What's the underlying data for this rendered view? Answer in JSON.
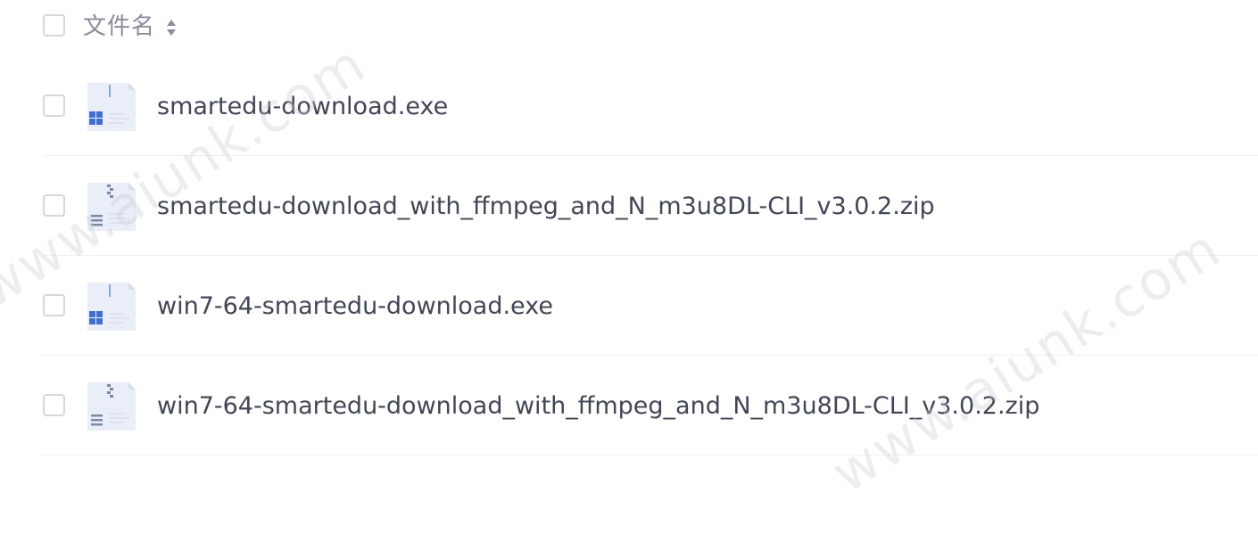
{
  "header": {
    "column_label": "文件名",
    "sort_icon": "sort-icon"
  },
  "files": [
    {
      "name": "smartedu-download.exe",
      "type": "exe",
      "icon": "exe-file-icon"
    },
    {
      "name": "smartedu-download_with_ffmpeg_and_N_m3u8DL-CLI_v3.0.2.zip",
      "type": "zip",
      "icon": "zip-file-icon"
    },
    {
      "name": "win7-64-smartedu-download.exe",
      "type": "exe",
      "icon": "exe-file-icon"
    },
    {
      "name": "win7-64-smartedu-download_with_ffmpeg_and_N_m3u8DL-CLI_v3.0.2.zip",
      "type": "zip",
      "icon": "zip-file-icon"
    }
  ],
  "watermark": "www.aiunk.com",
  "colors": {
    "checkbox_border": "#d4d7de",
    "header_text": "#878c9c",
    "file_text": "#414756",
    "icon_paper": "#e9eef8",
    "windows_blue": "#3f6fd6",
    "divider": "#eef0f3"
  }
}
